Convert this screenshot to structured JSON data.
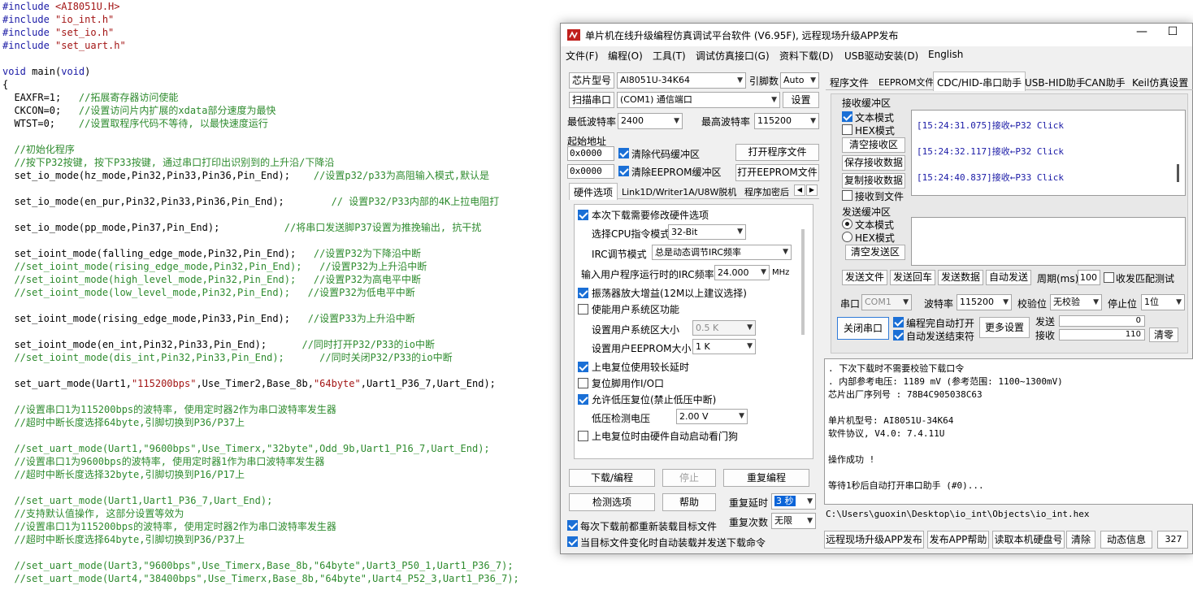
{
  "code_lines": [
    [
      {
        "c": "kw",
        "t": "#include "
      },
      {
        "c": "str",
        "t": "<AI8051U.H>"
      }
    ],
    [
      {
        "c": "kw",
        "t": "#include "
      },
      {
        "c": "str",
        "t": "\"io_int.h\""
      }
    ],
    [
      {
        "c": "kw",
        "t": "#include "
      },
      {
        "c": "str",
        "t": "\"set_io.h\""
      }
    ],
    [
      {
        "c": "kw",
        "t": "#include "
      },
      {
        "c": "str",
        "t": "\"set_uart.h\""
      }
    ],
    [],
    [
      {
        "c": "kw",
        "t": "void "
      },
      {
        "c": "pl",
        "t": "main("
      },
      {
        "c": "kw",
        "t": "void"
      },
      {
        "c": "pl",
        "t": ")"
      }
    ],
    [
      {
        "c": "pl",
        "t": "{"
      }
    ],
    [
      {
        "c": "pl",
        "t": "  EAXFR=1;   "
      },
      {
        "c": "cm",
        "t": "//拓展寄存器访问使能"
      }
    ],
    [
      {
        "c": "pl",
        "t": "  CKCON=0;   "
      },
      {
        "c": "cm",
        "t": "//设置访问片内扩展的xdata部分速度为最快"
      }
    ],
    [
      {
        "c": "pl",
        "t": "  WTST=0;    "
      },
      {
        "c": "cm",
        "t": "//设置取程序代码不等待, 以最快速度运行"
      }
    ],
    [],
    [
      {
        "c": "cm",
        "t": "  //初始化程序"
      }
    ],
    [
      {
        "c": "cm",
        "t": "  //按下P32按键, 按下P33按键, 通过串口打印出识别到的上升沿/下降沿"
      }
    ],
    [
      {
        "c": "pl",
        "t": "  set_io_mode(hz_mode,Pin32,Pin33,Pin36,Pin_End);    "
      },
      {
        "c": "cm",
        "t": "//设置p32/p33为高阻输入模式,默认是"
      }
    ],
    [],
    [
      {
        "c": "pl",
        "t": "  set_io_mode(en_pur,Pin32,Pin33,Pin36,Pin_End);        "
      },
      {
        "c": "cm",
        "t": "// 设置P32/P33内部的4K上拉电阻打"
      }
    ],
    [],
    [
      {
        "c": "pl",
        "t": "  set_io_mode(pp_mode,Pin37,Pin_End);           "
      },
      {
        "c": "cm",
        "t": "//将串口发送脚P37设置为推挽输出, 抗干扰"
      }
    ],
    [],
    [
      {
        "c": "pl",
        "t": "  set_ioint_mode(falling_edge_mode,Pin32,Pin_End);   "
      },
      {
        "c": "cm",
        "t": "//设置P32为下降沿中断"
      }
    ],
    [
      {
        "c": "cm",
        "t": "  //set_ioint_mode(rising_edge_mode,Pin32,Pin_End);   //设置P32为上升沿中断"
      }
    ],
    [
      {
        "c": "cm",
        "t": "  //set_ioint_mode(high_level_mode,Pin32,Pin_End);   //设置P32为高电平中断"
      }
    ],
    [
      {
        "c": "cm",
        "t": "  //set_ioint_mode(low_level_mode,Pin32,Pin_End);   //设置P32为低电平中断"
      }
    ],
    [],
    [
      {
        "c": "pl",
        "t": "  set_ioint_mode(rising_edge_mode,Pin33,Pin_End);   "
      },
      {
        "c": "cm",
        "t": "//设置P33为上升沿中断"
      }
    ],
    [],
    [
      {
        "c": "pl",
        "t": "  set_ioint_mode(en_int,Pin32,Pin33,Pin_End);      "
      },
      {
        "c": "cm",
        "t": "//同时打开P32/P33的io中断"
      }
    ],
    [
      {
        "c": "cm",
        "t": "  //set_ioint_mode(dis_int,Pin32,Pin33,Pin_End);      //同时关闭P32/P33的io中断"
      }
    ],
    [],
    [
      {
        "c": "pl",
        "t": "  set_uart_mode(Uart1,"
      },
      {
        "c": "str",
        "t": "\"115200bps\""
      },
      {
        "c": "pl",
        "t": ",Use_Timer2,Base_8b,"
      },
      {
        "c": "str",
        "t": "\"64byte\""
      },
      {
        "c": "pl",
        "t": ",Uart1_P36_7,Uart_End);"
      }
    ],
    [],
    [
      {
        "c": "cm",
        "t": "  //设置串口1为115200bps的波特率, 使用定时器2作为串口波特率发生器"
      }
    ],
    [
      {
        "c": "cm",
        "t": "  //超时中断长度选择64byte,引脚切换到P36/P37上"
      }
    ],
    [],
    [
      {
        "c": "cm",
        "t": "  //set_uart_mode(Uart1,\"9600bps\",Use_Timerx,\"32byte\",Odd_9b,Uart1_P16_7,Uart_End);"
      }
    ],
    [
      {
        "c": "cm",
        "t": "  //设置串口1为9600bps的波特率, 使用定时器1作为串口波特率发生器"
      }
    ],
    [
      {
        "c": "cm",
        "t": "  //超时中断长度选择32byte,引脚切换到P16/P17上"
      }
    ],
    [],
    [
      {
        "c": "cm",
        "t": "  //set_uart_mode(Uart1,Uart1_P36_7,Uart_End);"
      }
    ],
    [
      {
        "c": "cm",
        "t": "  //支持默认值操作, 这部分设置等效为"
      }
    ],
    [
      {
        "c": "cm",
        "t": "  //设置串口1为115200bps的波特率, 使用定时器2作为串口波特率发生器"
      }
    ],
    [
      {
        "c": "cm",
        "t": "  //超时中断长度选择64byte,引脚切换到P36/P37上"
      }
    ],
    [],
    [
      {
        "c": "cm",
        "t": "  //set_uart_mode(Uart3,\"9600bps\",Use_Timerx,Base_8b,\"64byte\",Uart3_P50_1,Uart1_P36_7);"
      }
    ],
    [
      {
        "c": "cm",
        "t": "  //set_uart_mode(Uart4,\"38400bps\",Use_Timerx,Base_8b,\"64byte\",Uart4_P52_3,Uart1_P36_7);"
      }
    ]
  ],
  "window": {
    "title": "单片机在线升级编程仿真调试平台软件 (V6.95F), 远程现场升级APP发布",
    "min": "—",
    "max": "☐"
  },
  "menu": [
    "文件(F)",
    "编程(O)",
    "工具(T)",
    "调试仿真接口(G)",
    "资料下载(D)",
    "USB驱动安装(D)",
    "English"
  ],
  "left": {
    "chip_label": "芯片型号",
    "chip_value": "AI8051U-34K64",
    "pin_label": "引脚数",
    "pin_value": "Auto",
    "scan_label": "扫描串口",
    "port_value": "(COM1) 通信端口",
    "settings_label": "设置",
    "min_baud_label": "最低波特率",
    "min_baud_value": "2400",
    "max_baud_label": "最高波特率",
    "max_baud_value": "115200",
    "start_addr_label": "起始地址",
    "addr1": "0x0000",
    "clear_code_label": "清除代码缓冲区",
    "open_prog_label": "打开程序文件",
    "addr2": "0x0000",
    "clear_eeprom_label": "清除EEPROM缓冲区",
    "open_eeprom_label": "打开EEPROM文件",
    "tabs": [
      "硬件选项",
      "Link1D/Writer1A/U8W脱机",
      "程序加密后"
    ],
    "hw": {
      "modify_label": "本次下载需要修改硬件选项",
      "cpu_mode_label": "选择CPU指令模式",
      "cpu_mode_value": "32-Bit",
      "irc_mode_label": "IRC调节模式",
      "irc_mode_value": "总是动态调节IRC频率",
      "irc_freq_label": "输入用户程序运行时的IRC频率",
      "irc_freq_value": "24.000",
      "irc_freq_unit": "MHz",
      "osc_gain_label": "振荡器放大增益(12M以上建议选择)",
      "user_sys_label": "使能用户系统区功能",
      "user_sys_size_label": "设置用户系统区大小",
      "user_sys_size_value": "0.5 K",
      "eeprom_size_label": "设置用户EEPROM大小",
      "eeprom_size_value": "1  K",
      "long_reset_label": "上电复位使用较长延时",
      "reset_io_label": "复位脚用作I/O口",
      "low_volt_label": "允许低压复位(禁止低压中断)",
      "low_volt_detect_label": "低压检测电压",
      "low_volt_value": "2.00 V",
      "watchdog_label": "上电复位时由硬件自动启动看门狗"
    },
    "download_label": "下载/编程",
    "stop_label": "停止",
    "reprogram_label": "重复编程",
    "detect_label": "检测选项",
    "help_label": "帮助",
    "repeat_delay_label": "重复延时",
    "repeat_delay_value": "3 秒",
    "repeat_count_label": "重复次数",
    "repeat_count_value": "无限",
    "reload_label": "每次下载前都重新装载目标文件",
    "auto_load_label": "当目标文件变化时自动装载并发送下载命令"
  },
  "right": {
    "tabs": [
      "程序文件",
      "EEPROM文件",
      "CDC/HID-串口助手",
      "USB-HID助手",
      "CAN助手",
      "Keil仿真设置"
    ],
    "recv_group": "接收缓冲区",
    "recv_text_mode": "文本模式",
    "recv_hex_mode": "HEX模式",
    "clear_recv": "清空接收区",
    "save_recv": "保存接收数据",
    "copy_recv": "复制接收数据",
    "recv_to_file": "接收到文件",
    "log": [
      "[15:24:31.075]接收←P32 Click",
      "[15:24:32.117]接收←P32 Click",
      "[15:24:40.837]接收←P33 Click"
    ],
    "send_group": "发送缓冲区",
    "send_text_mode": "文本模式",
    "send_hex_mode": "HEX模式",
    "clear_send": "清空发送区",
    "send_file": "发送文件",
    "send_return": "发送回车",
    "send_data": "发送数据",
    "auto_send": "自动发送",
    "period_label": "周期(ms)",
    "period_value": "100",
    "match_label": "收发匹配测试",
    "port_label": "串口",
    "port_value": "COM1",
    "baud_label": "波特率",
    "baud_value": "115200",
    "parity_label": "校验位",
    "parity_value": "无校验",
    "stopbit_label": "停止位",
    "stopbit_value": "1位",
    "close_port": "关闭串口",
    "auto_open_label": "编程完自动打开",
    "auto_send_end_label": "自动发送结束符",
    "more_settings": "更多设置",
    "send_count_label": "发送",
    "send_count": "0",
    "recv_count_label": "接收",
    "recv_count": "110",
    "clear_count": "清零"
  },
  "output": [
    ". 下次下载时不需要校验下载口令",
    ". 内部参考电压: 1189 mV (参考范围: 1100~1300mV)",
    "芯片出厂序列号 : 78B4C905038C63",
    "",
    "  单片机型号: AI8051U-34K64",
    "  软件协议, V4.0: 7.4.11U",
    "",
    "操作成功 !",
    "",
    "等待1秒后自动打开串口助手 (#0)..."
  ],
  "file_path": "C:\\Users\\guoxin\\Desktop\\io_int\\Objects\\io_int.hex",
  "bottom": {
    "remote_upgrade": "远程现场升级APP发布",
    "publish_help": "发布APP帮助",
    "read_disk": "读取本机硬盘号",
    "clear": "清除",
    "dynamic_info": "动态信息",
    "counter": "327"
  },
  "colors": {
    "keyword": "#1a1aa6",
    "string": "#a31515",
    "comment": "#2e8b2e",
    "check": "#1a6fd6"
  }
}
